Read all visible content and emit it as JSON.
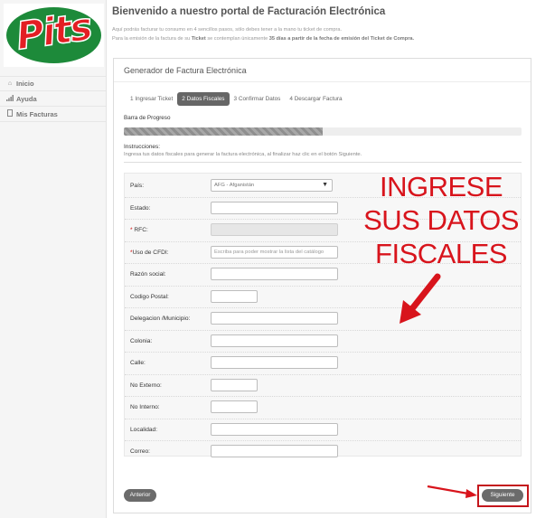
{
  "brand": {
    "logo_text": "Pits",
    "logo_green": "#1d8a3a",
    "logo_red": "#e31e24"
  },
  "sidebar": {
    "items": [
      {
        "label": "Inicio",
        "icon": "home-icon"
      },
      {
        "label": "Ayuda",
        "icon": "signal-icon"
      },
      {
        "label": "Mis Facturas",
        "icon": "document-icon"
      }
    ]
  },
  "header": {
    "title": "Bienvenido a nuestro portal de Facturación Electrónica",
    "intro_line1": "Aquí podrás facturar tu consumo en 4 sencillos pasos, sólo debes tener a la mano tu ticket de compra.",
    "intro_line2_pre": "Para la emisión de la factura de su ",
    "intro_line2_ticket": "Ticket",
    "intro_line2_mid": " se contemplan únicamente ",
    "intro_line2_bold": "35 días a partir de la fecha de emisión del Ticket de Compra."
  },
  "panel": {
    "title": "Generador de Factura Electrónica",
    "steps": [
      "1 Ingresar Ticket",
      "2 Datos Fiscales",
      "3 Confirmar Datos",
      "4 Descargar Factura"
    ],
    "active_step": 1,
    "progress_label": "Barra de Progreso",
    "progress": 0.5,
    "instructions_label": "Instrucciones:",
    "instructions_text": "Ingresa tus datos fiscales para generar la factura electrónica, al finalizar haz clic en el botón Siguiente."
  },
  "form": {
    "pais_label": "País:",
    "pais_value": "AFG - Afganistán",
    "estado_label": "Estado:",
    "rfc_label": "RFC:",
    "cfdi_label": "Uso de CFDI:",
    "cfdi_placeholder": "Escriba para poder mostrar la lista del catálogo",
    "razon_label": "Razón social:",
    "cp_label": "Codigo Postal:",
    "delegacion_label": "Delegacion /Municipio:",
    "colonia_label": "Colonia:",
    "calle_label": "Calle:",
    "noext_label": "No Externo:",
    "noint_label": "No Interno:",
    "localidad_label": "Localidad:",
    "correo_label": "Correo:"
  },
  "annotation": {
    "line1": "INGRESE",
    "line2": "SUS DATOS",
    "line3": "FISCALES",
    "color": "#d8141c"
  },
  "buttons": {
    "prev": "Anterior",
    "next": "Siguiente"
  }
}
